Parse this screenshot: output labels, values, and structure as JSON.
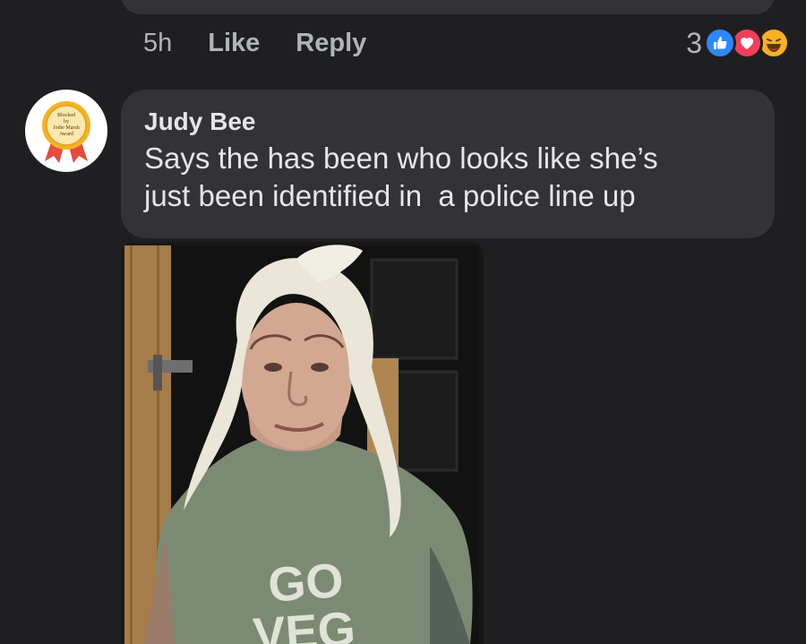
{
  "previous_comment": {
    "time": "5h",
    "like_label": "Like",
    "reply_label": "Reply",
    "reaction_count": "3",
    "reaction_icons": [
      "like-icon",
      "love-icon",
      "haha-icon"
    ]
  },
  "comment": {
    "author": "Judy Bee",
    "text": "Says the has been who looks like she’s\njust been identified in  a police line up",
    "avatar_badge": {
      "lines": [
        "Blocked",
        "by",
        "Jodie Marsh",
        "Award"
      ],
      "colors": {
        "medal": "#f5b323",
        "ribbon": "#e84a3c"
      }
    },
    "photo": {
      "shirt_text_line1": "GO",
      "shirt_text_line2": "VEG"
    }
  },
  "colors": {
    "background": "#1f1f21",
    "bubble": "#333336",
    "text_primary": "#e4e6eb",
    "text_secondary": "#b0b3b8",
    "like_blue": "#2d88ff",
    "love_red": "#f33e58",
    "haha_yellow": "#f7b125"
  }
}
